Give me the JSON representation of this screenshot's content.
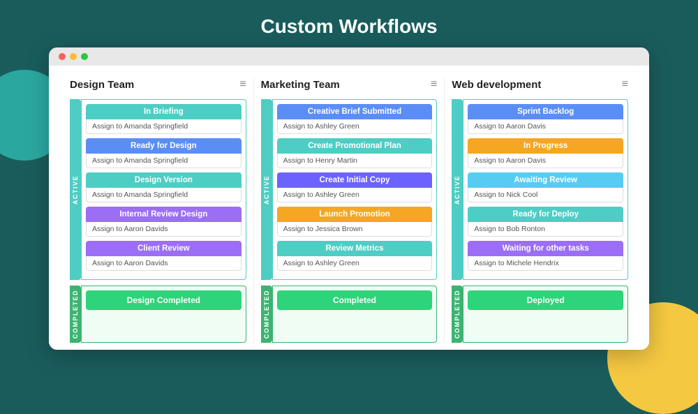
{
  "page": {
    "title": "Custom Workflows",
    "background_color": "#1a5c5c"
  },
  "browser": {
    "dots": [
      "red",
      "yellow",
      "green"
    ]
  },
  "columns": [
    {
      "id": "design-team",
      "title": "Design Team",
      "menu_icon": "≡",
      "active_label": "ACTIVE",
      "tasks": [
        {
          "label": "In Briefing",
          "color": "teal",
          "assign": "Assign to Amanda Springfield"
        },
        {
          "label": "Ready for Design",
          "color": "blue",
          "assign": "Assign to Amanda Springfield"
        },
        {
          "label": "Design Version",
          "color": "teal",
          "assign": "Assign to Amanda Springfield"
        },
        {
          "label": "Internal Review Design",
          "color": "purple",
          "assign": "Assign to Aaron Davids"
        },
        {
          "label": "Client Review",
          "color": "purple",
          "assign": "Assign to Aaron Davids"
        }
      ],
      "completed_label": "COMPLETED",
      "completed_task": "Design Completed"
    },
    {
      "id": "marketing-team",
      "title": "Marketing Team",
      "menu_icon": "≡",
      "active_label": "ACTIVE",
      "tasks": [
        {
          "label": "Creative Brief Submitted",
          "color": "blue",
          "assign": "Assign to Ashley Green"
        },
        {
          "label": "Create Promotional Plan",
          "color": "teal",
          "assign": "Assign to Henry Martin"
        },
        {
          "label": "Create Initial Copy",
          "color": "indigo",
          "assign": "Assign to Ashley Green"
        },
        {
          "label": "Launch Promotion",
          "color": "orange",
          "assign": "Assign to Jessica Brown"
        },
        {
          "label": "Review Metrics",
          "color": "teal",
          "assign": "Assign to Ashley Green"
        }
      ],
      "completed_label": "COMPLETED",
      "completed_task": "Completed"
    },
    {
      "id": "web-development",
      "title": "Web development",
      "menu_icon": "≡",
      "active_label": "ACTIVE",
      "tasks": [
        {
          "label": "Sprint Backlog",
          "color": "blue",
          "assign": "Assign to Aaron Davis"
        },
        {
          "label": "In Progress",
          "color": "orange",
          "assign": "Assign to Aaron Davis"
        },
        {
          "label": "Awaiting Review",
          "color": "cyan",
          "assign": "Assign to Nick Cool"
        },
        {
          "label": "Ready for Deploy",
          "color": "teal",
          "assign": "Assign to Bob Ronton"
        },
        {
          "label": "Waiting for other tasks",
          "color": "purple",
          "assign": "Assign to Michele Hendrix"
        }
      ],
      "completed_label": "COMPLETED",
      "completed_task": "Deployed"
    }
  ]
}
